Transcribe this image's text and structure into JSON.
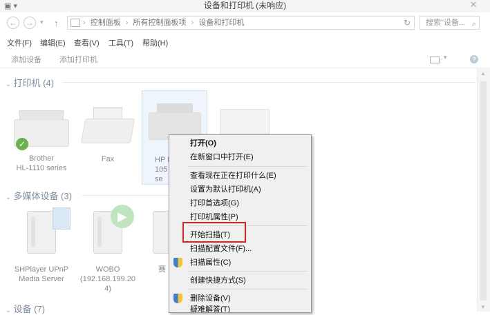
{
  "window": {
    "title": "设备和打印机 (未响应)",
    "close_glyph": "✕"
  },
  "address": {
    "back": "←",
    "forward": "→",
    "up": "↑",
    "breadcrumbs": [
      "控制面板",
      "所有控制面板项",
      "设备和打印机"
    ],
    "separator": "›",
    "refresh": "↻",
    "search_placeholder": "搜索\"设备...",
    "search_icon": "⌕"
  },
  "menubar": [
    "文件(F)",
    "编辑(E)",
    "查看(V)",
    "工具(T)",
    "帮助(H)"
  ],
  "toolbar": {
    "add_device": "添加设备",
    "add_printer": "添加打印机",
    "view_arrow": "▾",
    "help": "?"
  },
  "groups": {
    "printers": {
      "label": "打印机 (4)",
      "chevron": "⌄"
    },
    "media": {
      "label": "多媒体设备 (3)",
      "chevron": "⌄"
    },
    "devices": {
      "label": "设备 (7)",
      "chevron": "⌄"
    }
  },
  "printers": [
    {
      "label": "Brother\nHL-1110 series"
    },
    {
      "label": "Fax"
    },
    {
      "label": "HP I\n105\nse"
    }
  ],
  "media": [
    {
      "label": "SHPlayer UPnP\nMedia Server"
    },
    {
      "label": "WOBO\n(192.168.199.20\n4)"
    },
    {
      "label": "赛"
    }
  ],
  "context_menu": {
    "items": [
      {
        "label": "打开(O)",
        "bold": true,
        "shield": false
      },
      {
        "label": "在新窗口中打开(E)",
        "bold": false,
        "shield": false
      },
      {
        "label": "查看现在正在打印什么(E)",
        "bold": false,
        "shield": false
      },
      {
        "label": "设置为默认打印机(A)",
        "bold": false,
        "shield": false
      },
      {
        "label": "打印首选项(G)",
        "bold": false,
        "shield": false
      },
      {
        "label": "打印机属性(P)",
        "bold": false,
        "shield": false
      },
      {
        "label": "开始扫描(T)",
        "bold": false,
        "shield": false
      },
      {
        "label": "扫描配置文件(F)...",
        "bold": false,
        "shield": false
      },
      {
        "label": "扫描属性(C)",
        "bold": false,
        "shield": true
      },
      {
        "label": "创建快捷方式(S)",
        "bold": false,
        "shield": false
      },
      {
        "label": "删除设备(V)",
        "bold": false,
        "shield": true
      },
      {
        "label": "疑难解答(T)",
        "bold": false,
        "shield": false
      }
    ]
  },
  "colors": {
    "highlight_box": "#e12020",
    "group_text": "#7a8ca3"
  }
}
